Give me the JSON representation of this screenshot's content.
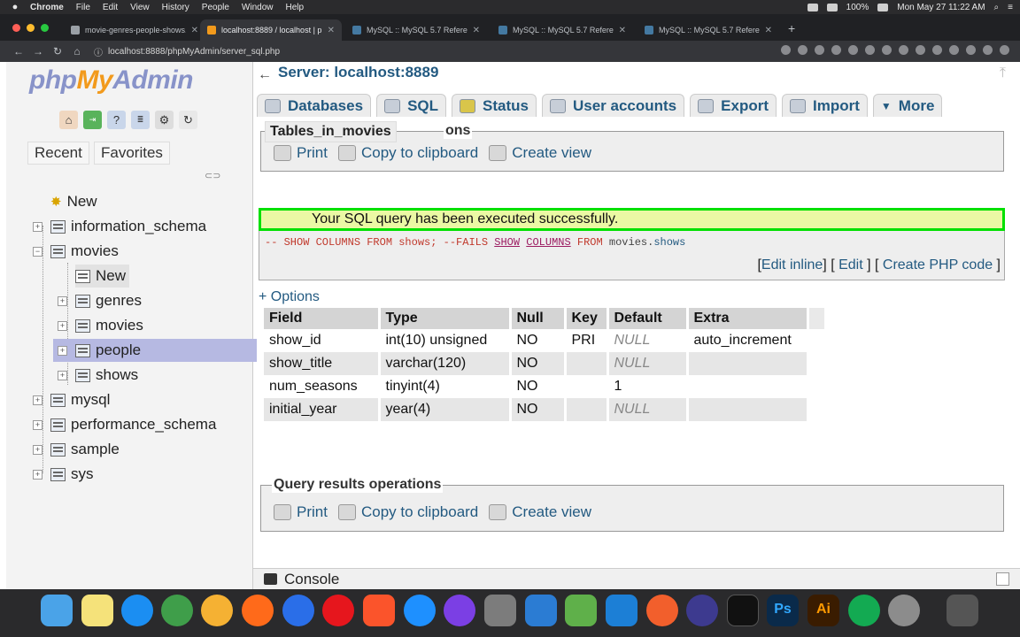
{
  "menubar": {
    "app": "Chrome",
    "items": [
      "File",
      "Edit",
      "View",
      "History",
      "People",
      "Window",
      "Help"
    ],
    "battery": "100%",
    "clock": "Mon May 27  11:22 AM"
  },
  "tabs": [
    {
      "label": "movie-genres-people-shows.s"
    },
    {
      "label": "localhost:8889 / localhost | ph"
    },
    {
      "label": "MySQL :: MySQL 5.7 Referenc"
    },
    {
      "label": "MySQL :: MySQL 5.7 Referenc"
    },
    {
      "label": "MySQL :: MySQL 5.7 Referenc"
    }
  ],
  "address": {
    "url": "localhost:8888/phpMyAdmin/server_sql.php"
  },
  "logo": {
    "php": "php",
    "my": "My",
    "admin": "Admin"
  },
  "nav": {
    "recent": "Recent",
    "favorites": "Favorites",
    "tree": {
      "new_root": "New",
      "information_schema": "information_schema",
      "movies": "movies",
      "movies_new": "New",
      "genres": "genres",
      "movies_table": "movies",
      "people": "people",
      "shows": "shows",
      "mysql": "mysql",
      "performance_schema": "performance_schema",
      "sample": "sample",
      "sys": "sys"
    }
  },
  "main": {
    "server": "Server: localhost:8889",
    "tabs": {
      "databases": "Databases",
      "sql": "SQL",
      "status": "Status",
      "user_accounts": "User accounts",
      "export": "Export",
      "import": "Import",
      "more": "More"
    },
    "tooltip": "Tables_in_movies",
    "legend_partial": "ons",
    "ops": {
      "print": "Print",
      "copy": "Copy to clipboard",
      "create_view": "Create view"
    },
    "success": "Your SQL query has been executed successfully.",
    "sql": {
      "comment": "-- SHOW COLUMNS FROM shows; --FAILS ",
      "kw1": "SHOW",
      "kw2": "COLUMNS",
      "kw3": " FROM ",
      "ident": "movies",
      "dot": ".",
      "table": "shows"
    },
    "links": {
      "edit_inline": "Edit inline",
      "edit": "Edit",
      "create_php": "Create PHP code"
    },
    "options": "+ Options",
    "table": {
      "headers": [
        "Field",
        "Type",
        "Null",
        "Key",
        "Default",
        "Extra"
      ],
      "rows": [
        [
          "show_id",
          "int(10) unsigned",
          "NO",
          "PRI",
          "NULL",
          "auto_increment"
        ],
        [
          "show_title",
          "varchar(120)",
          "NO",
          "",
          "NULL",
          ""
        ],
        [
          "num_seasons",
          "tinyint(4)",
          "NO",
          "",
          "1",
          ""
        ],
        [
          "initial_year",
          "year(4)",
          "NO",
          "",
          "NULL",
          ""
        ]
      ]
    },
    "qro_legend": "Query results operations",
    "console": "Console"
  },
  "dock": {
    "ps": "Ps",
    "ai": "Ai"
  }
}
